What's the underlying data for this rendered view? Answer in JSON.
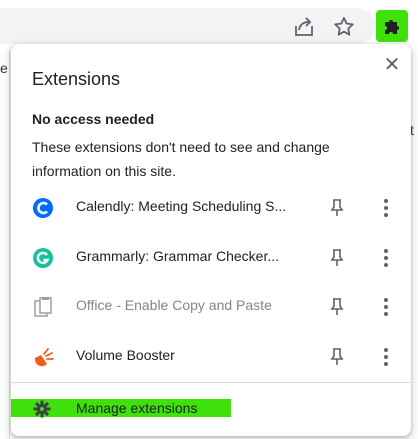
{
  "toolbar": {
    "share_icon": "share-icon",
    "star_icon": "star-icon",
    "extensions_icon": "puzzle-icon",
    "highlight_color": "#3fe10a"
  },
  "background": {
    "left_letter": "e",
    "right_letter": "t"
  },
  "popup": {
    "title": "Extensions",
    "close_symbol": "✕",
    "section_title": "No access needed",
    "section_desc": "These extensions don't need to see and change information on this site.",
    "extensions": [
      {
        "name": "Calendly: Meeting Scheduling S...",
        "icon": "calendly-icon",
        "enabled": true,
        "color": "#006bff"
      },
      {
        "name": "Grammarly: Grammar Checker...",
        "icon": "grammarly-icon",
        "enabled": true,
        "color": "#15c39a"
      },
      {
        "name": "Office - Enable Copy and Paste",
        "icon": "office-icon",
        "enabled": false,
        "color": "#9aa0a6"
      },
      {
        "name": "Volume Booster",
        "icon": "volume-booster-icon",
        "enabled": true,
        "color": "#f25c1d"
      }
    ],
    "manage_label": "Manage extensions",
    "manage_icon": "gear-icon"
  }
}
